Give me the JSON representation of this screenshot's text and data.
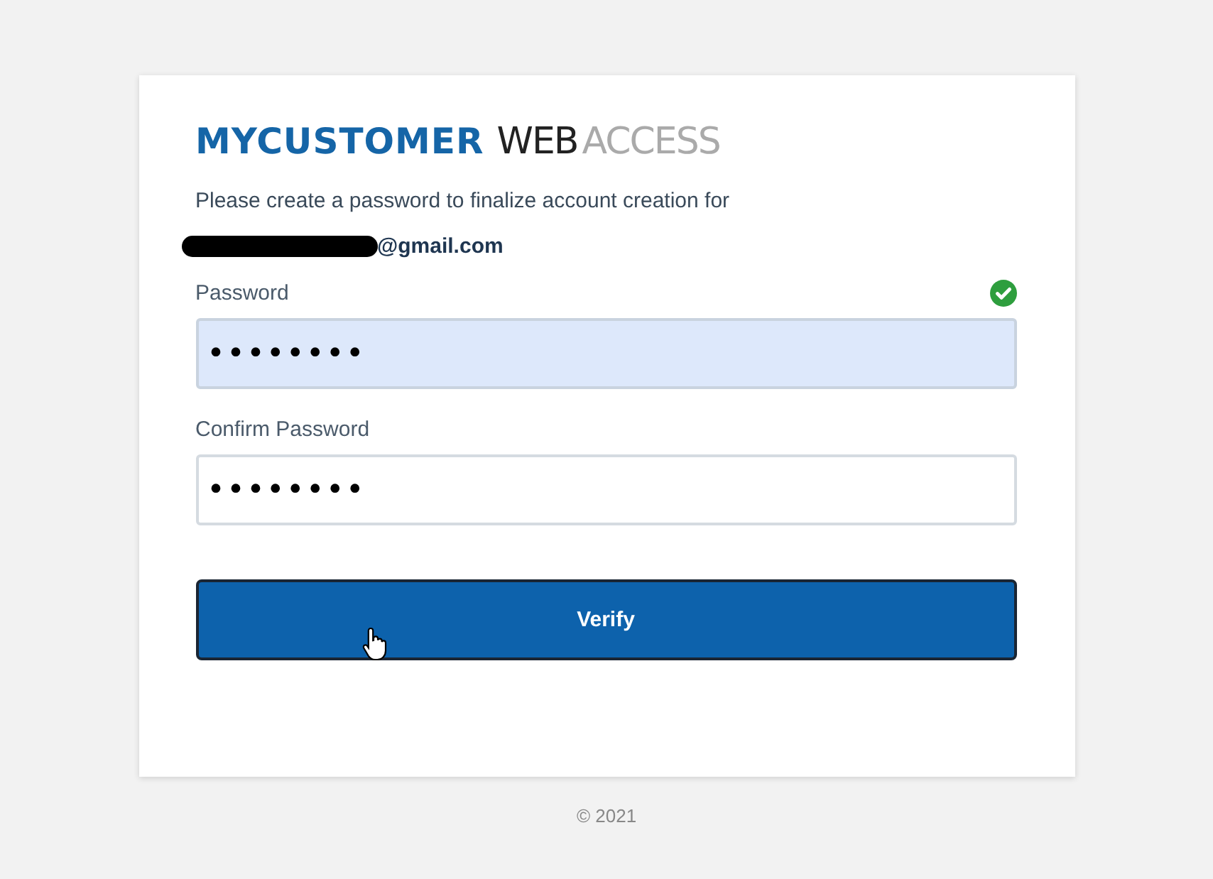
{
  "logo": [
    {
      "text": "MYCUSTOMER",
      "kind": "strong"
    },
    {
      "text": "WEB",
      "kind": "dark"
    },
    {
      "text": "ACCESS",
      "kind": "light"
    }
  ],
  "intro": "Please create a password to finalize account creation for",
  "email": {
    "redacted": true,
    "domain": "@gmail.com"
  },
  "fields": [
    {
      "label": "Password",
      "value": "••••••••",
      "autofilled": true,
      "valid": true
    },
    {
      "label": "Confirm Password",
      "value": "••••••••",
      "autofilled": false,
      "valid": false
    }
  ],
  "button": {
    "label": "Verify",
    "hovered": true
  },
  "footer": "© 2021"
}
